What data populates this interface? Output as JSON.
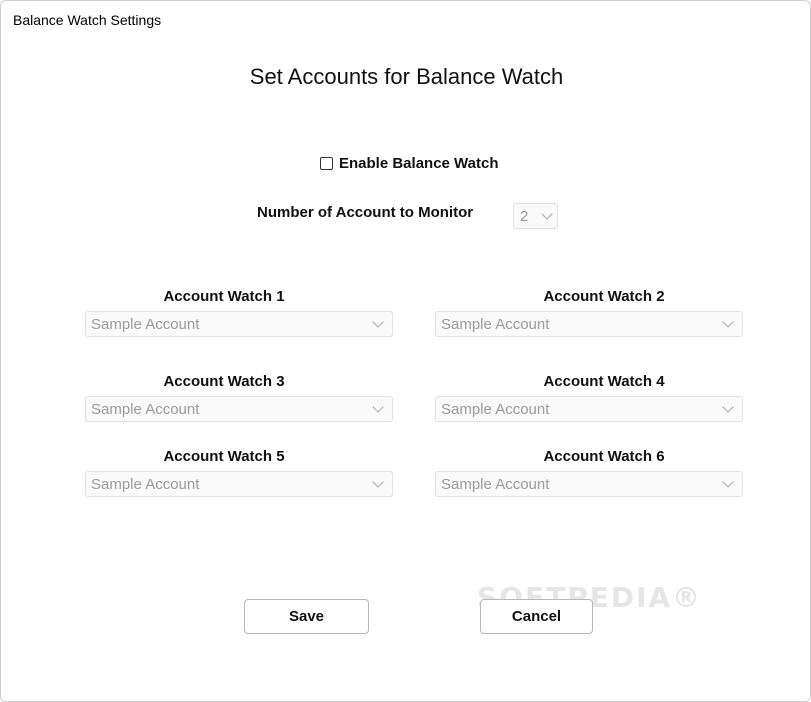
{
  "window": {
    "title": "Balance Watch Settings"
  },
  "heading": "Set Accounts for Balance Watch",
  "enable": {
    "label": "Enable Balance Watch",
    "checked": false
  },
  "num_accounts": {
    "label": "Number of Account to Monitor",
    "value": "2"
  },
  "watches": [
    {
      "label": "Account Watch 1",
      "value": "Sample Account"
    },
    {
      "label": "Account Watch 2",
      "value": "Sample Account"
    },
    {
      "label": "Account Watch 3",
      "value": "Sample Account"
    },
    {
      "label": "Account Watch 4",
      "value": "Sample Account"
    },
    {
      "label": "Account Watch 5",
      "value": "Sample Account"
    },
    {
      "label": "Account Watch 6",
      "value": "Sample Account"
    }
  ],
  "buttons": {
    "save": "Save",
    "cancel": "Cancel"
  },
  "watermark": "SOFTPEDIA®"
}
